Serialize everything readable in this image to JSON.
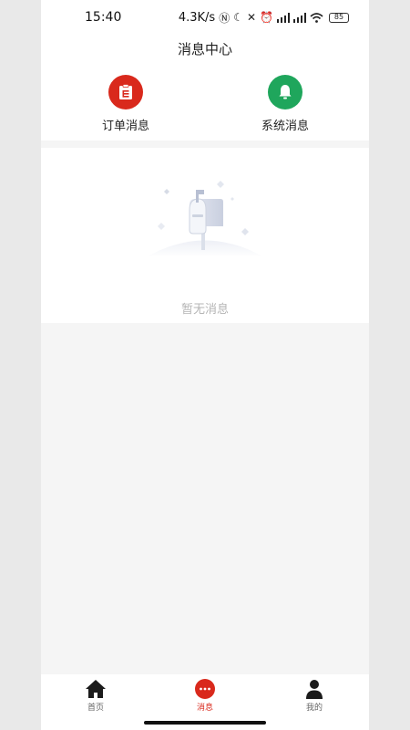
{
  "status_bar": {
    "time": "15:40",
    "net_speed": "4.3K/s",
    "battery": "85"
  },
  "header": {
    "title": "消息中心"
  },
  "categories": [
    {
      "label": "订单消息",
      "icon": "clipboard-icon",
      "color": "#d9291c"
    },
    {
      "label": "系统消息",
      "icon": "bell-icon",
      "color": "#1fa65c"
    }
  ],
  "empty_state": {
    "text": "暂无消息",
    "icon": "mailbox-icon"
  },
  "tabbar": {
    "items": [
      {
        "label": "首页",
        "icon": "home-icon",
        "active": false
      },
      {
        "label": "消息",
        "icon": "chat-bubble-icon",
        "active": true
      },
      {
        "label": "我的",
        "icon": "person-icon",
        "active": false
      }
    ],
    "active_color": "#d9291c"
  }
}
